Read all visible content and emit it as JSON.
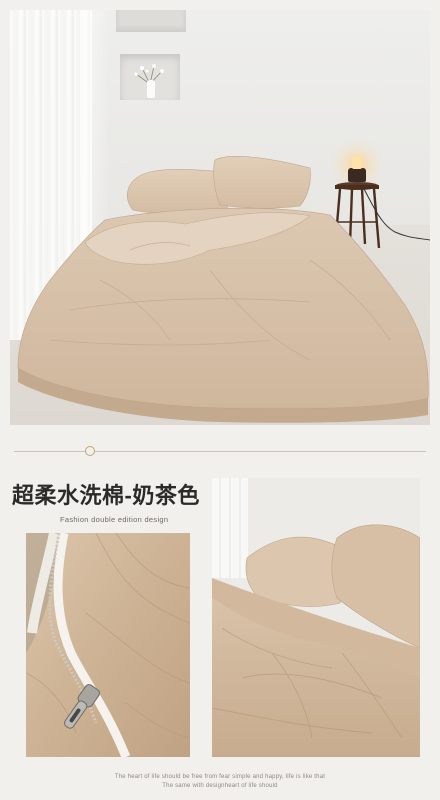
{
  "hero": {
    "photo": "bedroom-with-milk-tea-duvet"
  },
  "section": {
    "title": "超柔水洗棉-奶茶色",
    "subtitle": "Fashion double edition design"
  },
  "gallery": {
    "left_photo": "zipper-closeup",
    "right_photo": "pillows-and-duvet-closeup"
  },
  "footer": {
    "line1": "The heart of life should be free from fear simple and happy, life is like that",
    "line2": "The same with designheart of life should"
  },
  "colors": {
    "accent": "#c4a46a",
    "fabric": "#d2b99c",
    "background": "#f2f0ed"
  }
}
